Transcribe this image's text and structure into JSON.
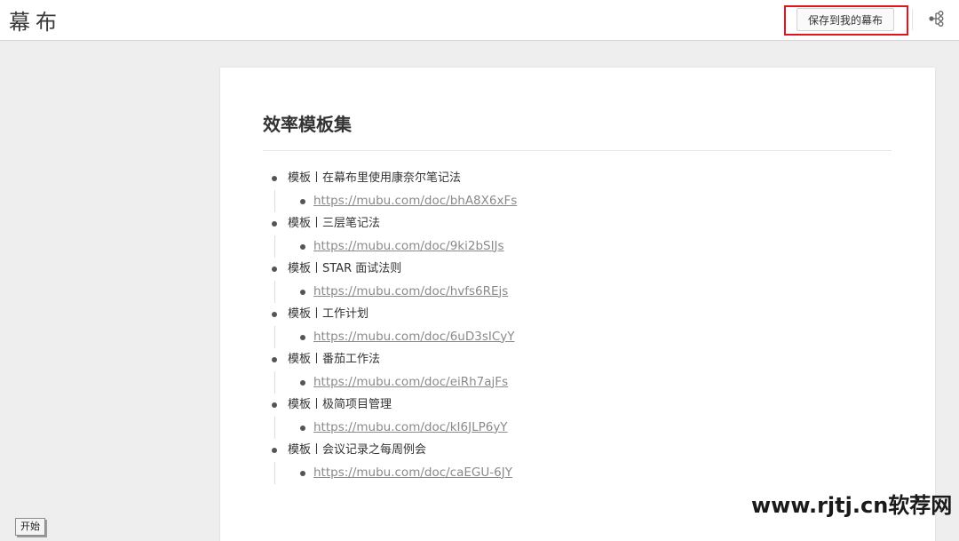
{
  "header": {
    "logo_text": "幕布",
    "save_button_label": "保存到我的幕布",
    "mindmap_icon": "mindmap-icon",
    "highlight_color": "#e0151d"
  },
  "document": {
    "title": "效率模板集",
    "items": [
      {
        "label": "模板丨在幕布里使用康奈尔笔记法",
        "link": "https://mubu.com/doc/bhA8X6xFs"
      },
      {
        "label": "模板丨三层笔记法",
        "link": "https://mubu.com/doc/9ki2bSIJs"
      },
      {
        "label": "模板丨STAR 面试法则",
        "link": "https://mubu.com/doc/hvfs6REjs"
      },
      {
        "label": "模板丨工作计划",
        "link": "https://mubu.com/doc/6uD3sICyY"
      },
      {
        "label": "模板丨番茄工作法",
        "link": "https://mubu.com/doc/eiRh7ajFs"
      },
      {
        "label": "模板丨极简项目管理",
        "link": "https://mubu.com/doc/kI6JLP6yY"
      },
      {
        "label": "模板丨会议记录之每周例会",
        "link": "https://mubu.com/doc/caEGU-6JY"
      }
    ]
  },
  "footer": {
    "start_button_label": "开始",
    "watermark_text": "www.rjtj.cn软荐网"
  }
}
